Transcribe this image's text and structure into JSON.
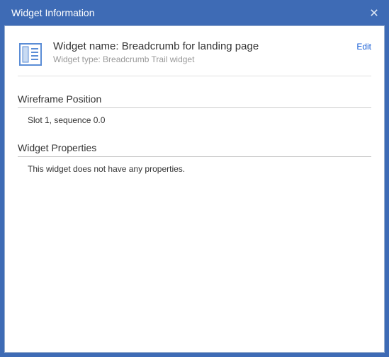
{
  "dialog": {
    "title": "Widget Information"
  },
  "header": {
    "name_label": "Widget name: Breadcrumb for landing page",
    "type_label": "Widget type: Breadcrumb Trail widget",
    "edit_label": "Edit"
  },
  "sections": {
    "wireframe": {
      "title": "Wireframe Position",
      "body": "Slot 1, sequence 0.0"
    },
    "properties": {
      "title": "Widget Properties",
      "body": "This widget does not have any properties."
    }
  }
}
